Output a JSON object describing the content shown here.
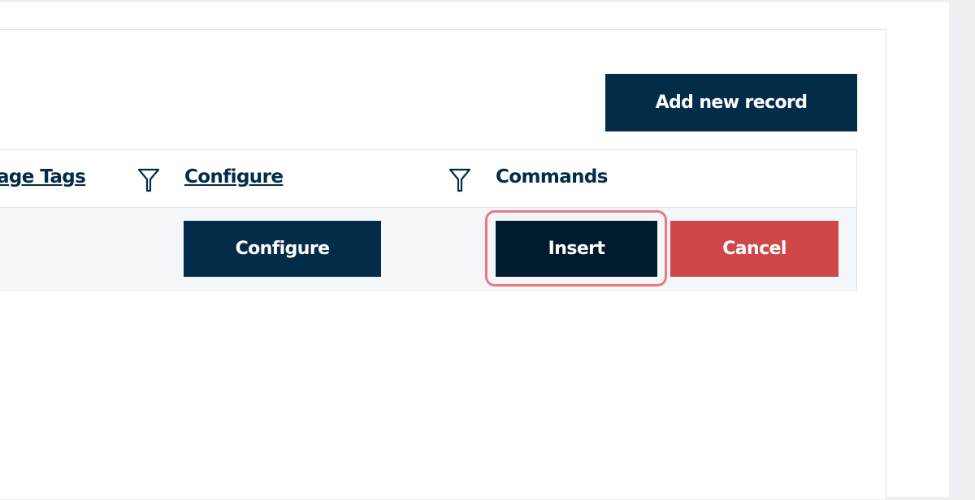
{
  "toolbar": {
    "add_new_record_label": "Add new record"
  },
  "grid": {
    "columns": [
      {
        "label": "age Tags",
        "filterable": true
      },
      {
        "label": "Configure",
        "filterable": true
      },
      {
        "label": "Commands",
        "filterable": false
      }
    ],
    "row": {
      "configure_label": "Configure",
      "insert_label": "Insert",
      "cancel_label": "Cancel"
    }
  },
  "icons": {
    "filter": "filter-icon"
  },
  "colors": {
    "primary": "#022c47",
    "insert": "#001b2e",
    "cancel": "#d0474a",
    "highlight": "#f0787a",
    "border": "#d6e2ee"
  }
}
